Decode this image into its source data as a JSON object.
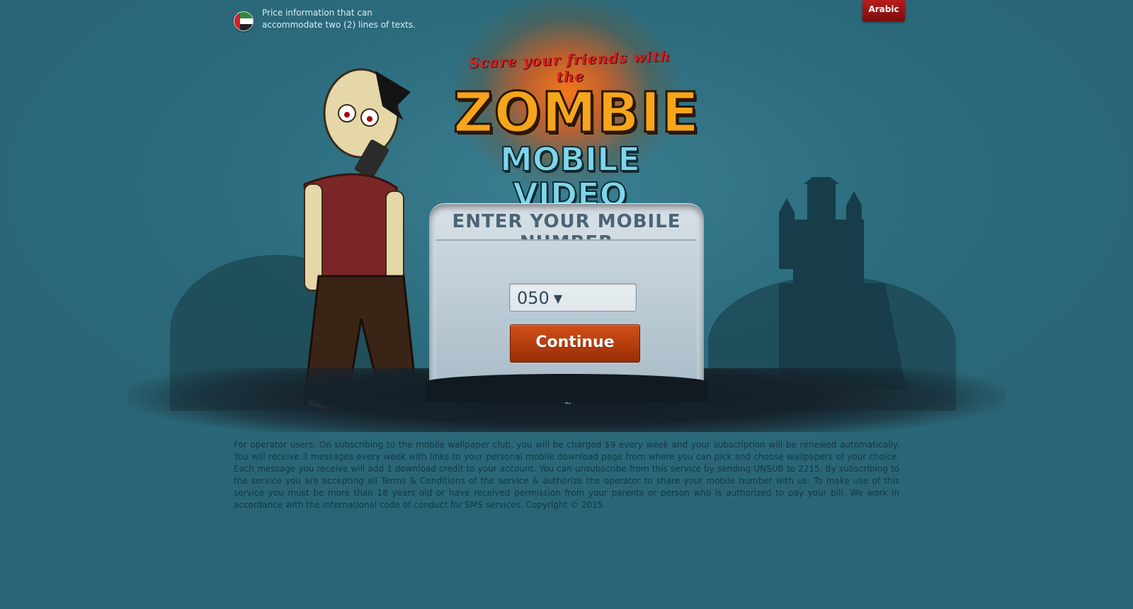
{
  "header": {
    "price_info": "Price information that can accommodate two (2) lines of texts.",
    "language_button": "Arabic",
    "flag_icon": "uae-flag-icon"
  },
  "logo": {
    "tagline": "Scare your friends with the",
    "title": "ZOMBIE",
    "subtitle": "MOBILE VIDEO"
  },
  "form": {
    "title": "Enter your mobile number",
    "prefix_selected": "050",
    "dropdown_icon": "chevron-down-icon",
    "continue_label": "Continue"
  },
  "footer": {
    "disclaimer": "For operator users: On subscribing to the mobile wallpaper club, you will be charged $9 every week and your subscription will be renewed automatically. You will receive 3 messages every week with links to your personal mobile download page from where you can pick and choose wallpapers of your choice. Each message you receive will add 1 download credit to your account. You can unsubscribe from this service by sending UNSUB to 2215. By subscribing to the service you are accepting all Terms & Conditions of the service & authorize the operator to share your mobile number with us. To make use of this service you must be more than 18 years old or have received permission from your parents or person who is authorized to pay your bill. We work in accordance with the international code of conduct for SMS services. Copyright © 2015."
  },
  "colors": {
    "background": "#2f6b7b",
    "glow": "#f07a1c",
    "button": "#b33d0d",
    "language_button": "#9a1414"
  }
}
